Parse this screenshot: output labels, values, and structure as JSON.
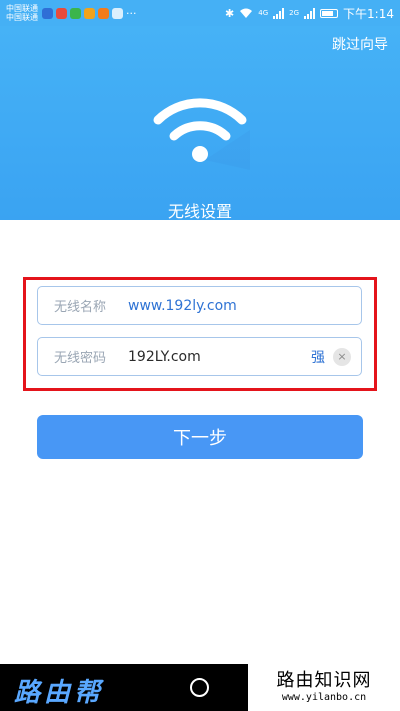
{
  "status_bar": {
    "carrier_1": "中国联通",
    "carrier_2": "中国联通",
    "overflow": "···",
    "network_4g": "4G",
    "network_2g": "2G",
    "time": "下午1:14"
  },
  "header": {
    "skip_label": "跳过向导",
    "title": "无线设置"
  },
  "form": {
    "ssid_label": "无线名称",
    "ssid_value": "www.192ly.com",
    "password_label": "无线密码",
    "password_value": "192LY.com",
    "strength": "强",
    "clear_glyph": "×"
  },
  "next_label": "下一步",
  "watermark": {
    "left": "路由帮",
    "right_title": "路由知识网",
    "right_url": "www.yilanbo.cn"
  },
  "colors": {
    "header_blue": "#46b2f6",
    "button_blue": "#4897f5",
    "highlight_red": "#e4141b"
  }
}
